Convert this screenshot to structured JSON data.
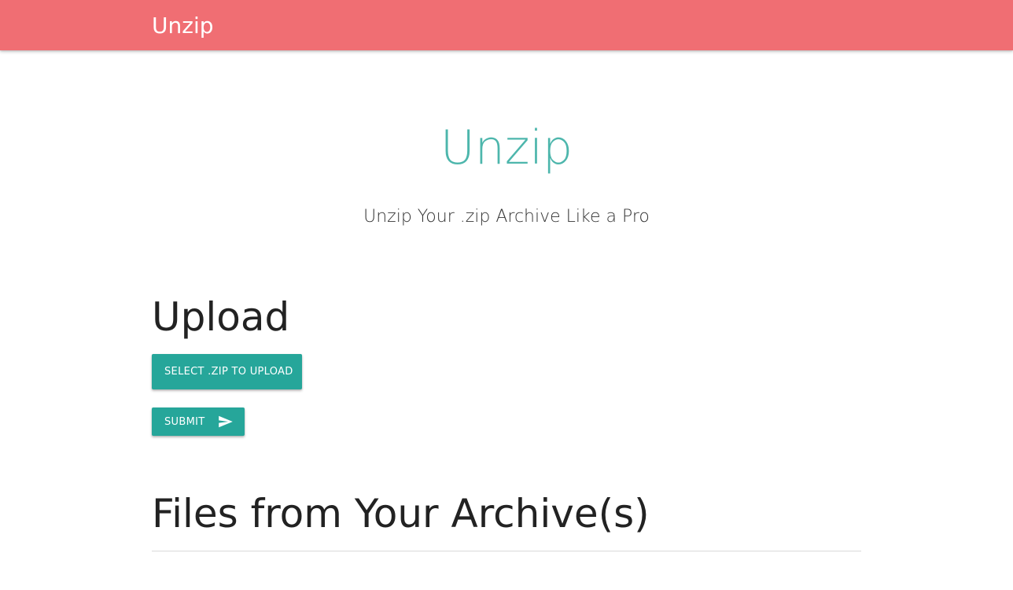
{
  "navbar": {
    "brand": "Unzip",
    "color": "#f06e73"
  },
  "hero": {
    "title": "Unzip",
    "subtitle": "Unzip Your .zip Archive Like a Pro",
    "title_color": "#4db6ac"
  },
  "upload": {
    "heading": "Upload",
    "select_button_label": "SELECT .ZIP TO UPLOAD",
    "submit_button_label": "SUBMIT",
    "submit_icon": "send-icon",
    "button_color": "#26a69a"
  },
  "archive": {
    "heading": "Files from Your Archive(s)"
  }
}
